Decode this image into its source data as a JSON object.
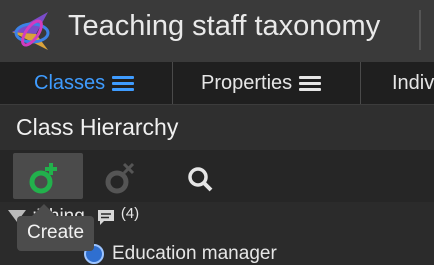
{
  "app": {
    "title": "Teaching staff taxonomy",
    "logo_icon": "ontology-logo-icon"
  },
  "tabs": [
    {
      "label": "Classes",
      "active": true,
      "icon": "hamburger-icon"
    },
    {
      "label": "Properties",
      "active": false,
      "icon": "hamburger-icon"
    },
    {
      "label": "Indiv",
      "active": false
    }
  ],
  "panel": {
    "title": "Class Hierarchy"
  },
  "toolbar": {
    "create_icon": "add-class-icon",
    "delete_icon": "delete-class-icon",
    "search_icon": "search-icon",
    "tooltip": "Create"
  },
  "tree": {
    "root": {
      "label": ":Thing",
      "comment_count": "(4)",
      "comment_icon": "comment-icon"
    },
    "child": {
      "label": "Education manager",
      "icon": "class-circle-icon"
    }
  },
  "colors": {
    "active_tab": "#3f9cff",
    "create_green": "#22b14c",
    "class_blue": "#2f6fd0"
  }
}
